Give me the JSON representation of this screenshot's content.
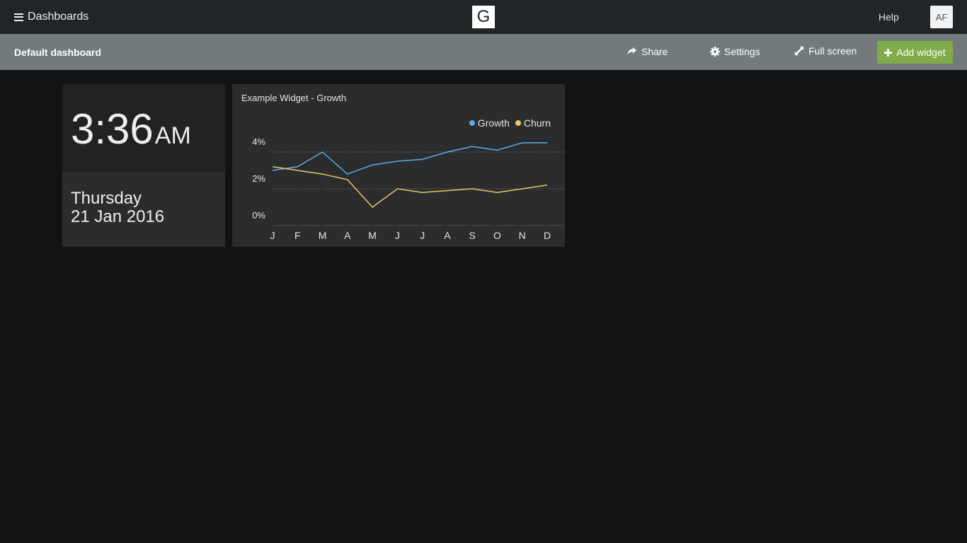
{
  "topbar": {
    "menu_label": "Dashboards",
    "logo_text": "G",
    "help_label": "Help",
    "avatar_initials": "AF"
  },
  "subbar": {
    "dashboard_title": "Default dashboard",
    "share_label": "Share",
    "settings_label": "Settings",
    "fullscreen_label": "Full screen",
    "add_widget_label": "Add widget",
    "icons": {
      "share": "share-icon",
      "settings": "gear-icon",
      "fullscreen": "expand-icon",
      "add": "plus-icon"
    },
    "add_widget_color": "#7fac4a"
  },
  "clock": {
    "time": "3:36",
    "ampm": "AM",
    "day": "Thursday",
    "date": "21 Jan 2016"
  },
  "chart_widget": {
    "title": "Example Widget - Growth"
  },
  "chart_data": {
    "type": "line",
    "title": "Example Widget - Growth",
    "categories": [
      "J",
      "F",
      "M",
      "A",
      "M",
      "J",
      "J",
      "A",
      "S",
      "O",
      "N",
      "D"
    ],
    "ylim": [
      0,
      4
    ],
    "yticks": [
      "4%",
      "2%",
      "0%"
    ],
    "ytick_values": [
      4,
      2,
      0
    ],
    "grid": true,
    "legend_position": "top-right",
    "series": [
      {
        "name": "Growth",
        "color": "#5aafe8",
        "values": [
          3.0,
          3.2,
          4.0,
          2.8,
          3.3,
          3.5,
          3.6,
          4.0,
          4.3,
          4.1,
          4.5,
          4.5
        ]
      },
      {
        "name": "Churn",
        "color": "#e8c765",
        "values": [
          3.2,
          3.0,
          2.8,
          2.5,
          1.0,
          2.0,
          1.8,
          1.9,
          2.0,
          1.8,
          2.0,
          2.2
        ]
      }
    ]
  }
}
